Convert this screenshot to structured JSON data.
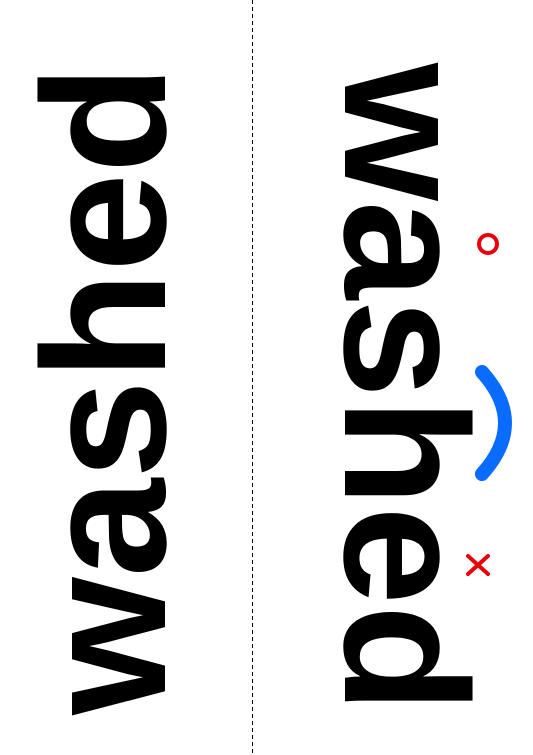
{
  "left_word": "washed",
  "right_word": "washed",
  "colors": {
    "background": "#ffffff",
    "text": "#000000",
    "divider": "#000000",
    "circle_mark": "#e8000b",
    "cross_mark": "#e8000b",
    "arc_mark": "#0a6cff"
  },
  "marks": {
    "circle": "circle-mark",
    "arc": "arc-mark",
    "cross": "cross-mark"
  }
}
